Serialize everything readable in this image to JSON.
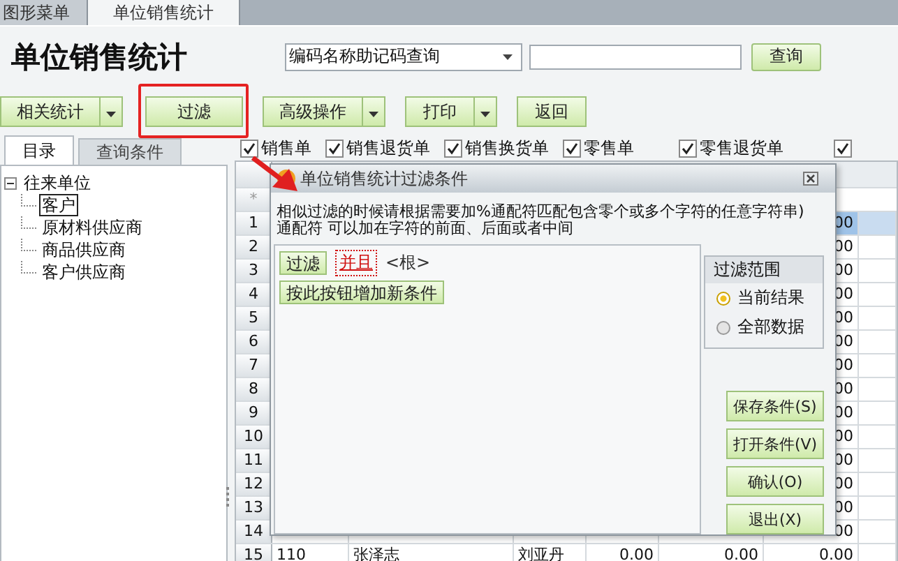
{
  "top_tabs": [
    {
      "label": "图形菜单",
      "selected": false
    },
    {
      "label": "单位销售统计",
      "selected": true
    }
  ],
  "header": {
    "title": "单位销售统计",
    "search_mode": "编码名称助记码查询",
    "query_button": "查询"
  },
  "toolbar": [
    {
      "label": "相关统计",
      "dropdown": true,
      "highlighted": false
    },
    {
      "label": "过滤",
      "dropdown": false,
      "highlighted": true
    },
    {
      "label": "高级操作",
      "dropdown": true,
      "highlighted": false
    },
    {
      "label": "打印",
      "dropdown": true,
      "highlighted": false
    },
    {
      "label": "返回",
      "dropdown": false,
      "highlighted": false
    }
  ],
  "left_tabs": [
    {
      "label": "目录",
      "selected": true
    },
    {
      "label": "查询条件",
      "selected": false
    }
  ],
  "tree": [
    {
      "label": "往来单位",
      "expanded": true,
      "selected": false,
      "children": [
        {
          "label": "客户",
          "selected": true
        },
        {
          "label": "原材料供应商",
          "selected": false
        },
        {
          "label": "商品供应商",
          "selected": false
        },
        {
          "label": "客户供应商",
          "selected": false
        }
      ]
    }
  ],
  "filters": [
    {
      "label": "销售单",
      "checked": true
    },
    {
      "label": "销售退货单",
      "checked": true
    },
    {
      "label": "销售换货单",
      "checked": true
    },
    {
      "label": "零售单",
      "checked": true
    },
    {
      "label": "零售退货单",
      "checked": true
    },
    {
      "checked": true
    }
  ],
  "grid": {
    "new_row_marker": "*",
    "rows": [
      {
        "number": "1",
        "selected": true,
        "kind": "covered",
        "tail": "00"
      },
      {
        "number": "2",
        "selected": false,
        "kind": "covered",
        "tail": "00"
      },
      {
        "number": "3",
        "selected": false,
        "kind": "covered",
        "tail": "00"
      },
      {
        "number": "4",
        "selected": false,
        "kind": "covered",
        "tail": "00"
      },
      {
        "number": "5",
        "selected": false,
        "kind": "covered",
        "tail": "00"
      },
      {
        "number": "6",
        "selected": false,
        "kind": "covered",
        "tail": "00"
      },
      {
        "number": "7",
        "selected": false,
        "kind": "covered",
        "tail": "00"
      },
      {
        "number": "8",
        "selected": false,
        "kind": "covered",
        "tail": "00"
      },
      {
        "number": "9",
        "selected": false,
        "kind": "covered",
        "tail": "00"
      },
      {
        "number": "10",
        "selected": false,
        "kind": "covered",
        "tail": "00"
      },
      {
        "number": "11",
        "selected": false,
        "kind": "covered",
        "tail": "00"
      },
      {
        "number": "12",
        "selected": false,
        "kind": "covered",
        "tail": "00"
      },
      {
        "number": "13",
        "selected": false,
        "kind": "covered",
        "tail": "00"
      },
      {
        "number": "14",
        "selected": false,
        "kind": "covered",
        "tail": "00"
      },
      {
        "number": "15",
        "selected": false,
        "kind": "full",
        "cells": [
          "110",
          "张泽志",
          "刘亚丹",
          "0.00",
          "0.00",
          "0.00"
        ]
      }
    ]
  },
  "dialog": {
    "title": "单位销售统计过滤条件",
    "hint": "相似过滤的时候请根据需要加%通配符匹配包含零个或多个字符的任意字符串)通配符 可以加在字符的前面、后面或者中间",
    "filter_button": "过滤",
    "operator": "并且",
    "root": "<根>",
    "add_condition_button": "按此按钮增加新条件",
    "scope": {
      "title": "过滤范围",
      "options": [
        {
          "label": "当前结果",
          "selected": true
        },
        {
          "label": "全部数据",
          "selected": false
        }
      ]
    },
    "buttons": [
      "保存条件(S)",
      "打开条件(V)",
      "确认(O)",
      "退出(X)"
    ]
  }
}
